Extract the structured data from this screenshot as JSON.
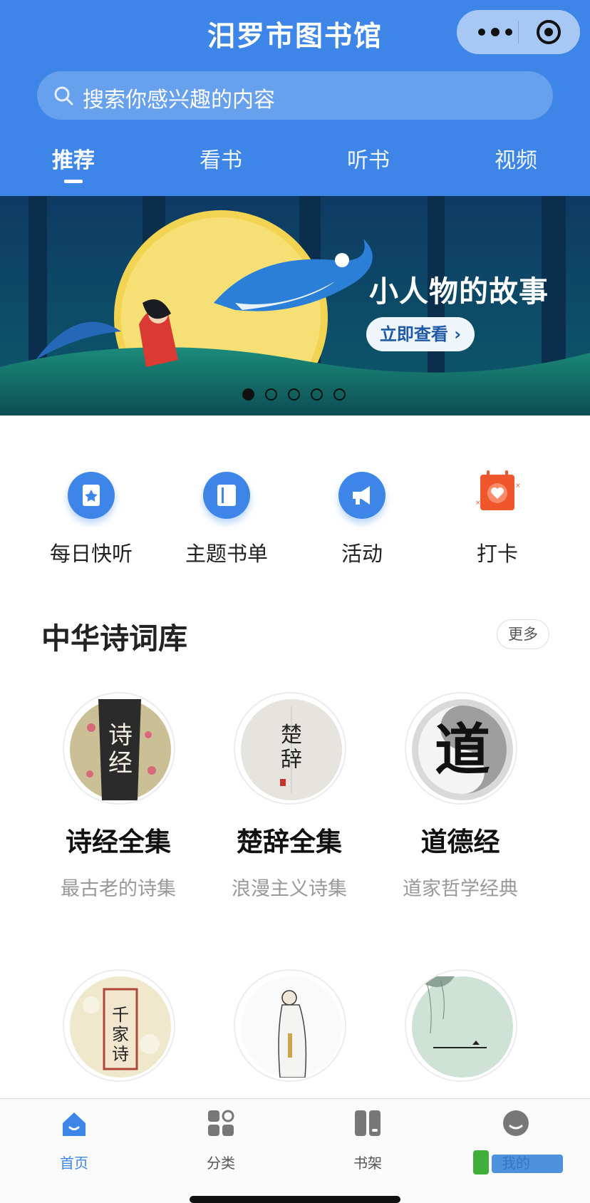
{
  "header": {
    "title": "汨罗市图书馆",
    "search_placeholder": "搜索你感兴趣的内容",
    "tabs": [
      {
        "label": "推荐",
        "active": true
      },
      {
        "label": "看书",
        "active": false
      },
      {
        "label": "听书",
        "active": false
      },
      {
        "label": "视频",
        "active": false
      }
    ]
  },
  "banner": {
    "title": "小人物的故事",
    "button_label": "立即查看 ›",
    "slide_count": 5,
    "active_slide": 1
  },
  "quick_links": [
    {
      "label": "每日快听",
      "icon": "headphone-book-icon"
    },
    {
      "label": "主题书单",
      "icon": "book-icon"
    },
    {
      "label": "活动",
      "icon": "megaphone-icon"
    },
    {
      "label": "打卡",
      "icon": "calendar-heart-icon"
    }
  ],
  "poetry": {
    "section_title": "中华诗词库",
    "more_label": "更多",
    "items": [
      {
        "name": "诗经全集",
        "desc": "最古老的诗集",
        "cover_text": "诗经"
      },
      {
        "name": "楚辞全集",
        "desc": "浪漫主义诗集",
        "cover_text": "楚辞"
      },
      {
        "name": "道德经",
        "desc": "道家哲学经典",
        "cover_text": "道"
      },
      {
        "name": "",
        "desc": "",
        "cover_text": "千家诗"
      },
      {
        "name": "",
        "desc": "",
        "cover_text": ""
      },
      {
        "name": "",
        "desc": "",
        "cover_text": ""
      }
    ]
  },
  "bottom_nav": [
    {
      "label": "首页",
      "icon": "home-icon",
      "active": true
    },
    {
      "label": "分类",
      "icon": "category-icon",
      "active": false
    },
    {
      "label": "书架",
      "icon": "bookshelf-icon",
      "active": false
    },
    {
      "label": "我的",
      "icon": "profile-icon",
      "active": false
    }
  ],
  "colors": {
    "primary": "#3d86e8",
    "checkin": "#f0562c"
  }
}
